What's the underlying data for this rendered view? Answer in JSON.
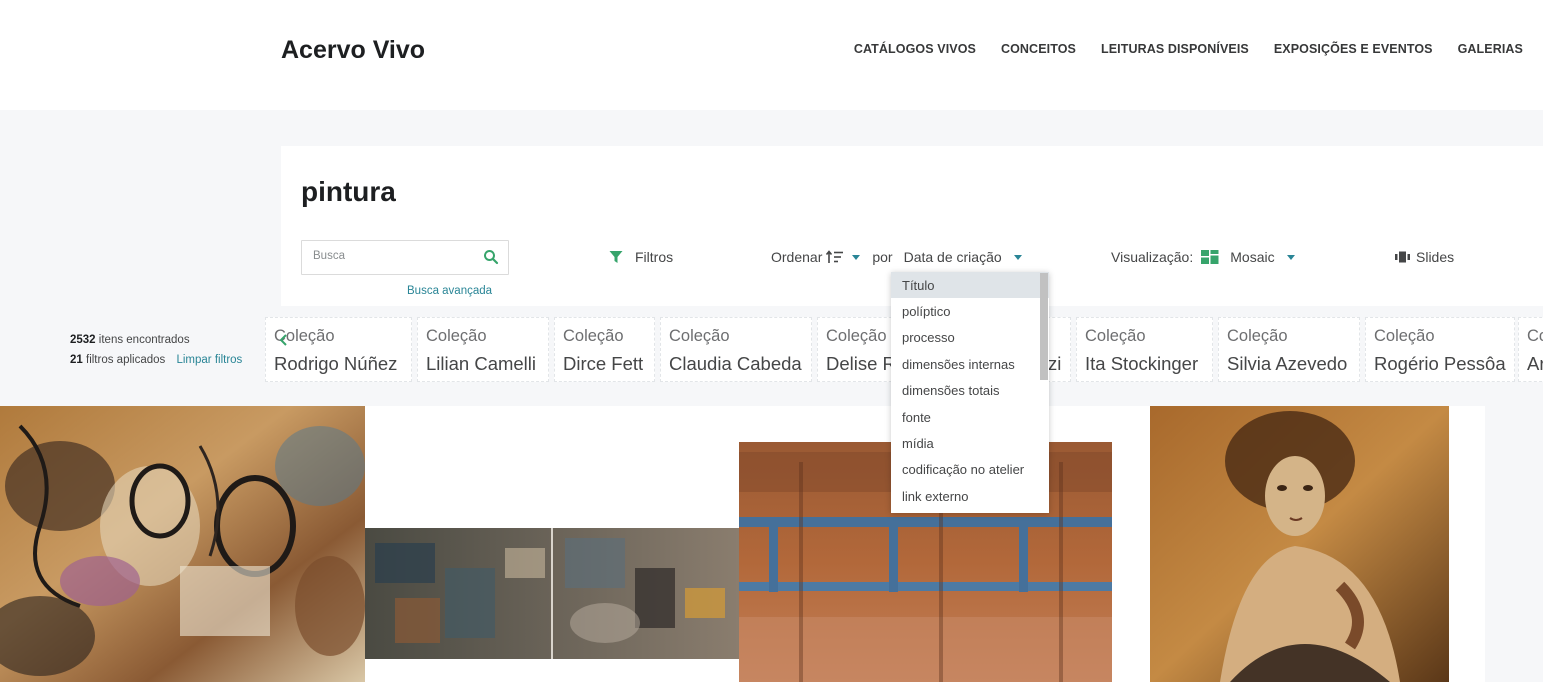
{
  "site": {
    "title": "Acervo Vivo",
    "nav": [
      "CATÁLOGOS VIVOS",
      "CONCEITOS",
      "LEITURAS DISPONÍVEIS",
      "EXPOSIÇÕES E EVENTOS",
      "GALERIAS"
    ]
  },
  "search": {
    "title": "pintura",
    "placeholder": "Busca",
    "advanced_label": "Busca avançada",
    "filters_label": "Filtros",
    "sort_label": "Ordenar",
    "sort_by_prefix": "por",
    "sort_by_value": "Data de criação",
    "view_label": "Visualização:",
    "view_value": "Mosaic",
    "slides_label": "Slides"
  },
  "sort_dropdown": {
    "selected_index": 0,
    "options": [
      "Título",
      "políptico",
      "processo",
      "dimensões internas",
      "dimensões totais",
      "fonte",
      "mídia",
      "codificação no atelier",
      "link externo"
    ]
  },
  "results": {
    "count": "2532",
    "count_suffix": "itens encontrados",
    "filters_count": "21",
    "filters_suffix": "filtros aplicados",
    "clear_label": "Limpar filtros"
  },
  "filter_tags": [
    {
      "type": "Coleção",
      "value": "Rodrigo Núñez"
    },
    {
      "type": "Coleção",
      "value": "Lilian Camelli"
    },
    {
      "type": "Coleção",
      "value": "Dirce Fett"
    },
    {
      "type": "Coleção",
      "value": "Claudia Cabeda"
    },
    {
      "type": "Coleção",
      "value": "Delise R"
    },
    {
      "type": "",
      "value": "zi"
    },
    {
      "type": "Coleção",
      "value": "Ita Stockinger"
    },
    {
      "type": "Coleção",
      "value": "Silvia Azevedo"
    },
    {
      "type": "Coleção",
      "value": "Rogério Pessôa"
    },
    {
      "type": "Co",
      "value": "Ar"
    }
  ],
  "colors": {
    "accent": "#298596",
    "icon_green": "#36a46b",
    "header_bg": "#ffffff",
    "page_bg": "#f6f7f9"
  },
  "icons": {
    "search": "search-icon",
    "filter": "funnel-icon",
    "sort": "sort-ascending-icon",
    "view": "mosaic-grid-icon",
    "slides": "slides-icon"
  }
}
